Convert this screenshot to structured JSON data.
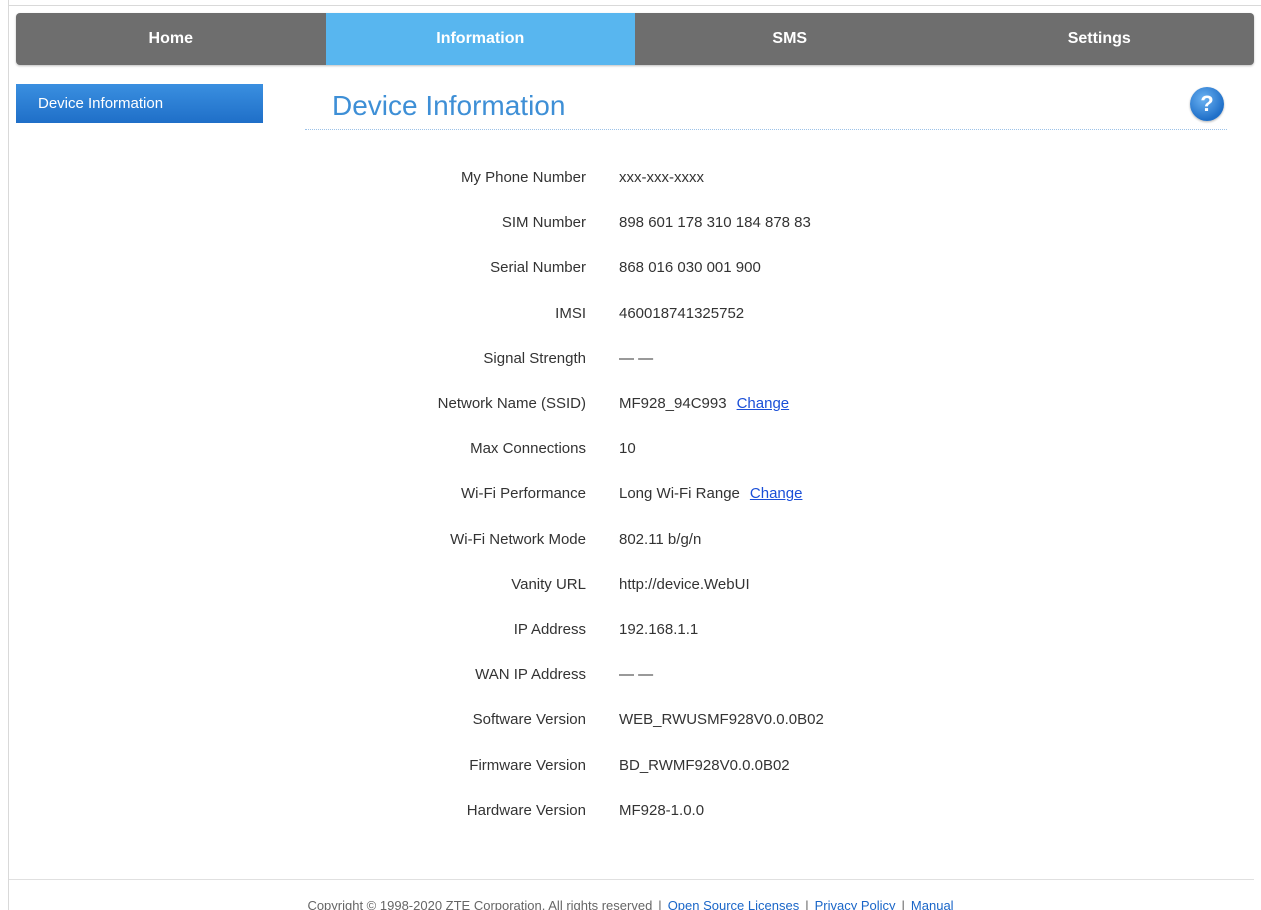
{
  "nav": {
    "tabs": [
      "Home",
      "Information",
      "SMS",
      "Settings"
    ],
    "active": "Information"
  },
  "sidebar": {
    "items": [
      {
        "label": "Device Information"
      }
    ]
  },
  "main": {
    "title": "Device Information",
    "help_icon": "?",
    "rows": [
      {
        "label": "My Phone Number",
        "value": "xxx-xxx-xxxx"
      },
      {
        "label": "SIM Number",
        "value": "898 601 178 310 184 878 83"
      },
      {
        "label": "Serial Number",
        "value": "868 016 030 001 900"
      },
      {
        "label": "IMSI",
        "value": "460018741325752"
      },
      {
        "label": "Signal Strength",
        "value": "— —"
      },
      {
        "label": "Network Name (SSID)",
        "value": "MF928_94C993",
        "link": "Change"
      },
      {
        "label": "Max Connections",
        "value": "10"
      },
      {
        "label": "Wi-Fi Performance",
        "value": "Long Wi-Fi Range",
        "link": "Change"
      },
      {
        "label": "Wi-Fi Network Mode",
        "value": "802.11 b/g/n"
      },
      {
        "label": "Vanity URL",
        "value": "http://device.WebUI"
      },
      {
        "label": "IP Address",
        "value": "192.168.1.1"
      },
      {
        "label": "WAN IP Address",
        "value": "— —"
      },
      {
        "label": "Software Version",
        "value": "WEB_RWUSMF928V0.0.0B02"
      },
      {
        "label": "Firmware Version",
        "value": "BD_RWMF928V0.0.0B02"
      },
      {
        "label": "Hardware Version",
        "value": "MF928-1.0.0"
      }
    ]
  },
  "footer": {
    "copyright": "Copyright © 1998-2020 ZTE Corporation. All rights reserved",
    "separator": "|",
    "links": [
      "Open Source Licenses",
      "Privacy Policy",
      "Manual"
    ]
  },
  "colors": {
    "nav_bg": "#6e6e6e",
    "nav_active": "#58b6ef",
    "title": "#3e8fd6",
    "link": "#1a4fd8"
  }
}
